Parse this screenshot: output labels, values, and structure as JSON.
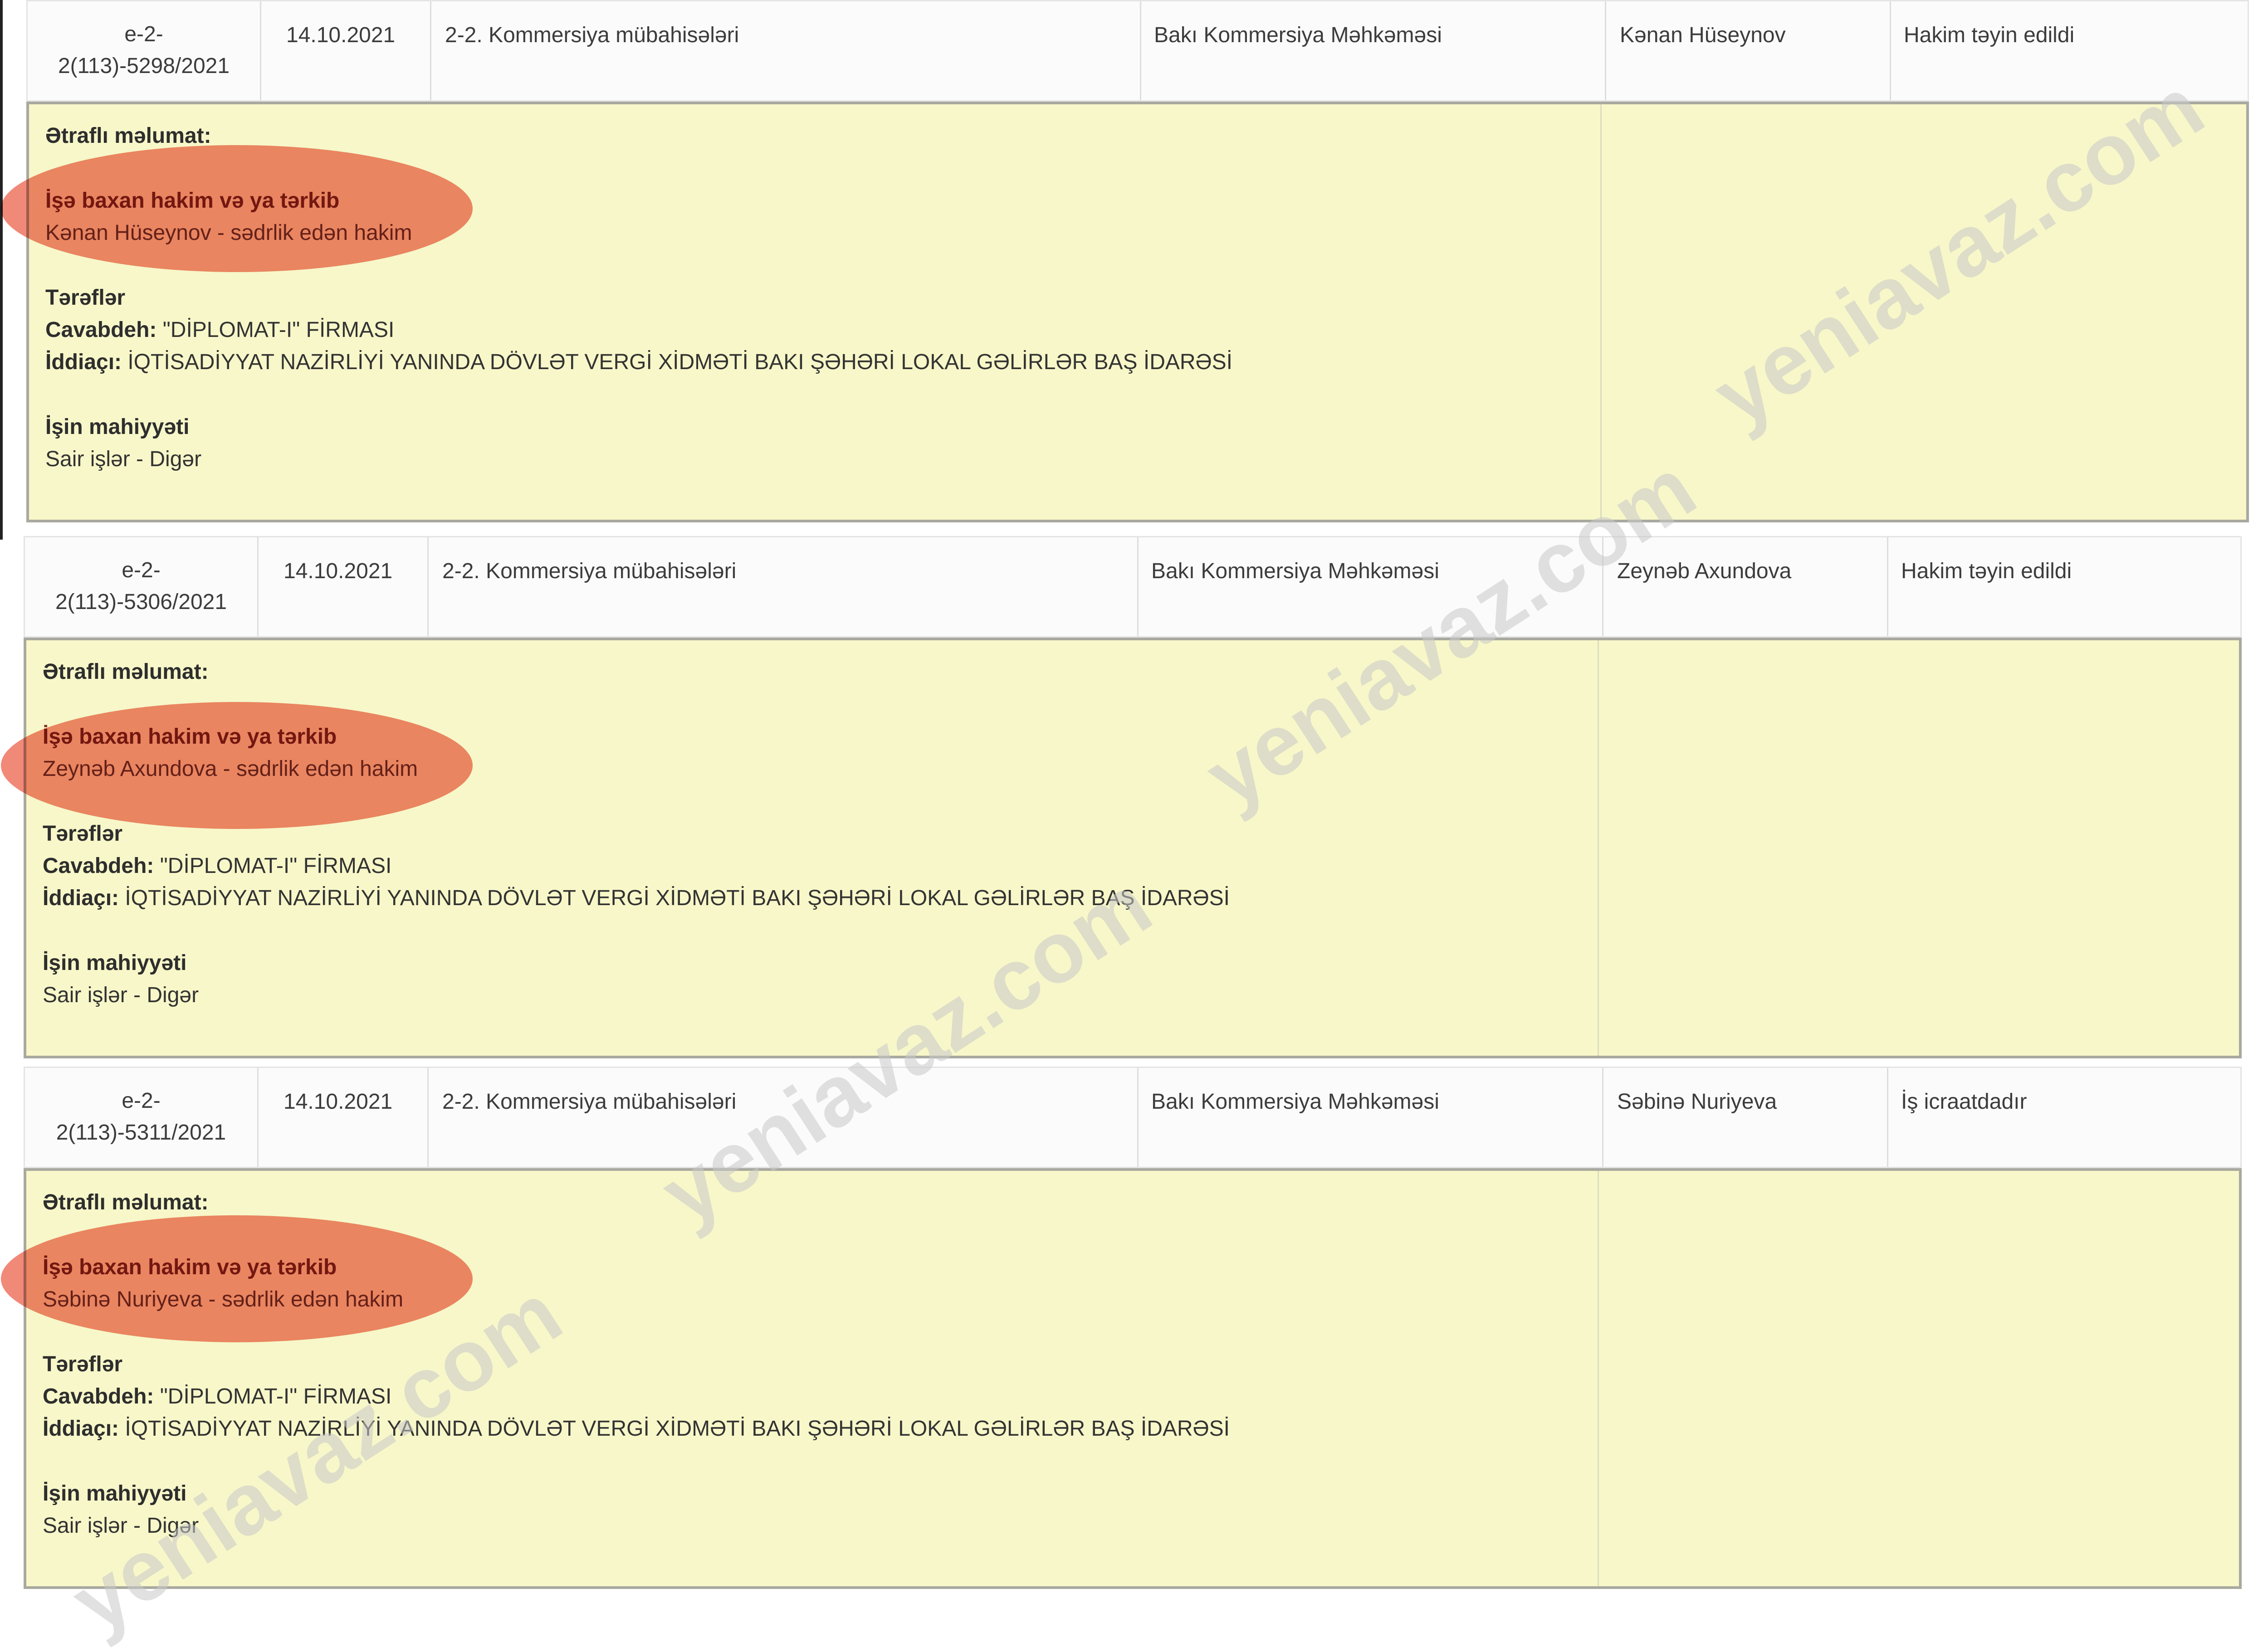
{
  "watermark": "yeniavaz.com",
  "labels": {
    "details_title": "Ətraflı məlumat:",
    "judge_section": "İşə baxan hakim və ya tərkib",
    "parties": "Tərəflər",
    "defendant": "Cavabdeh:",
    "plaintiff": "İddiaçı:",
    "nature": "İşin mahiyyəti"
  },
  "cases": [
    {
      "case_id_line1": "e-2-",
      "case_id_line2": "2(113)-5298/2021",
      "date": "14.10.2021",
      "category": "2-2. Kommersiya mübahisələri",
      "court": "Bakı Kommersiya Məhkəməsi",
      "judge": "Kənan Hüseynov",
      "status": "Hakim təyin edildi",
      "judge_detail": "Kənan Hüseynov - sədrlik edən hakim",
      "defendant": "\"DİPLOMAT-I\" FİRMASI",
      "plaintiff": "İQTİSADİYYAT NAZİRLİYİ YANINDA DÖVLƏT VERGİ XİDMƏTİ BAKI ŞƏHƏRİ LOKAL GƏLİRLƏR BAŞ İDARƏSİ",
      "nature": "Sair işlər - Digər"
    },
    {
      "case_id_line1": "e-2-",
      "case_id_line2": "2(113)-5306/2021",
      "date": "14.10.2021",
      "category": "2-2. Kommersiya mübahisələri",
      "court": "Bakı Kommersiya Məhkəməsi",
      "judge": "Zeynəb Axundova",
      "status": "Hakim təyin edildi",
      "judge_detail": "Zeynəb Axundova - sədrlik edən hakim",
      "defendant": "\"DİPLOMAT-I\" FİRMASI",
      "plaintiff": "İQTİSADİYYAT NAZİRLİYİ YANINDA DÖVLƏT VERGİ XİDMƏTİ BAKI ŞƏHƏRİ LOKAL GƏLİRLƏR BAŞ İDARƏSİ",
      "nature": "Sair işlər - Digər"
    },
    {
      "case_id_line1": "e-2-",
      "case_id_line2": "2(113)-5311/2021",
      "date": "14.10.2021",
      "category": "2-2. Kommersiya mübahisələri",
      "court": "Bakı Kommersiya Məhkəməsi",
      "judge": "Səbinə Nuriyeva",
      "status": "İş icraatdadır",
      "judge_detail": "Səbinə Nuriyeva - sədrlik edən hakim",
      "defendant": "\"DİPLOMAT-I\" FİRMASI",
      "plaintiff": "İQTİSADİYYAT NAZİRLİYİ YANINDA DÖVLƏT VERGİ XİDMƏTİ BAKI ŞƏHƏRİ LOKAL GƏLİRLƏR BAŞ İDARƏSİ",
      "nature": "Sair işlər - Digər"
    }
  ],
  "colors": {
    "details_bg": "#f7f7c9",
    "highlight": "#ee7462",
    "judge_text": "#7a2a22"
  }
}
